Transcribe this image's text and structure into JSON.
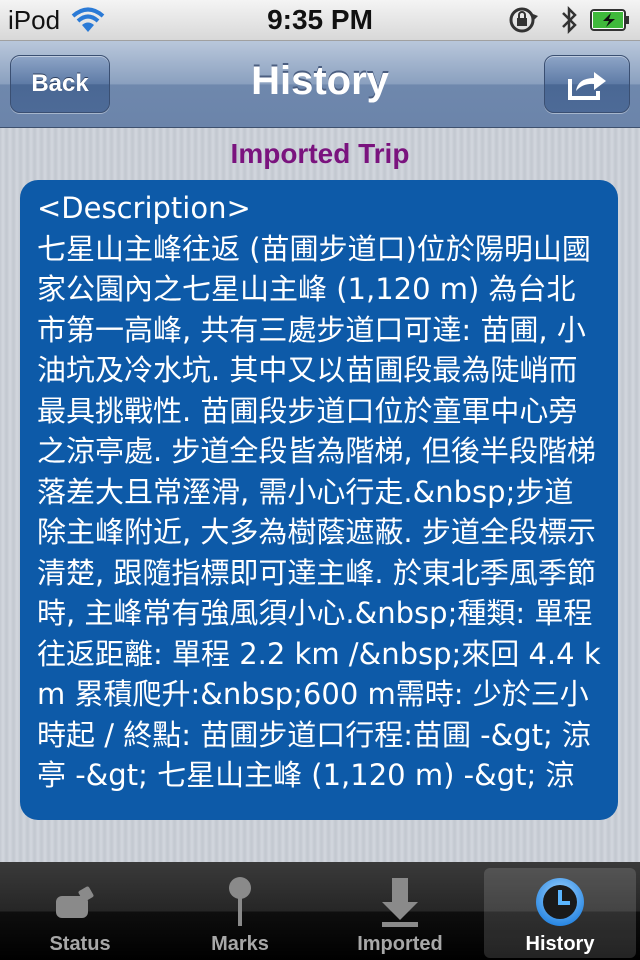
{
  "status_bar": {
    "carrier": "iPod",
    "time": "9:35 PM"
  },
  "nav": {
    "title": "History",
    "back_label": "Back",
    "share_icon": "share-icon"
  },
  "section_title": "Imported Trip",
  "description": "<Description>\n七星山主峰往返 (苗圃步道口)位於陽明山國家公園內之七星山主峰 (1,120 m) 為台北市第一高峰, 共有三處步道口可達: 苗圃, 小油坑及冷水坑. 其中又以苗圃段最為陡峭而最具挑戰性. 苗圃段步道口位於童軍中心旁之涼亭處. 步道全段皆為階梯, 但後半段階梯落差大且常溼滑, 需小心行走.&nbsp;步道除主峰附近, 大多為樹蔭遮蔽. 步道全段標示清楚, 跟隨指標即可達主峰. 於東北季風季節時, 主峰常有強風須小心.&nbsp;種類: 單程往返距離: 單程 2.2 km /&nbsp;來回 4.4 km 累積爬升:&nbsp;600 m需時: 少於三小時起 / 終點: 苗圃步道口行程:苗圃 -&gt; 涼亭 -&gt; 七星山主峰 (1,120 m) -&gt; 涼",
  "tabs": [
    {
      "label": "Status",
      "icon": "status-icon"
    },
    {
      "label": "Marks",
      "icon": "pin-icon"
    },
    {
      "label": "Imported",
      "icon": "download-arrow-icon"
    },
    {
      "label": "History",
      "icon": "clock-icon",
      "active": true
    }
  ],
  "colors": {
    "accent_title": "#7a137e",
    "desc_bg": "#0d5aa8",
    "tab_active": "#ffffff"
  }
}
